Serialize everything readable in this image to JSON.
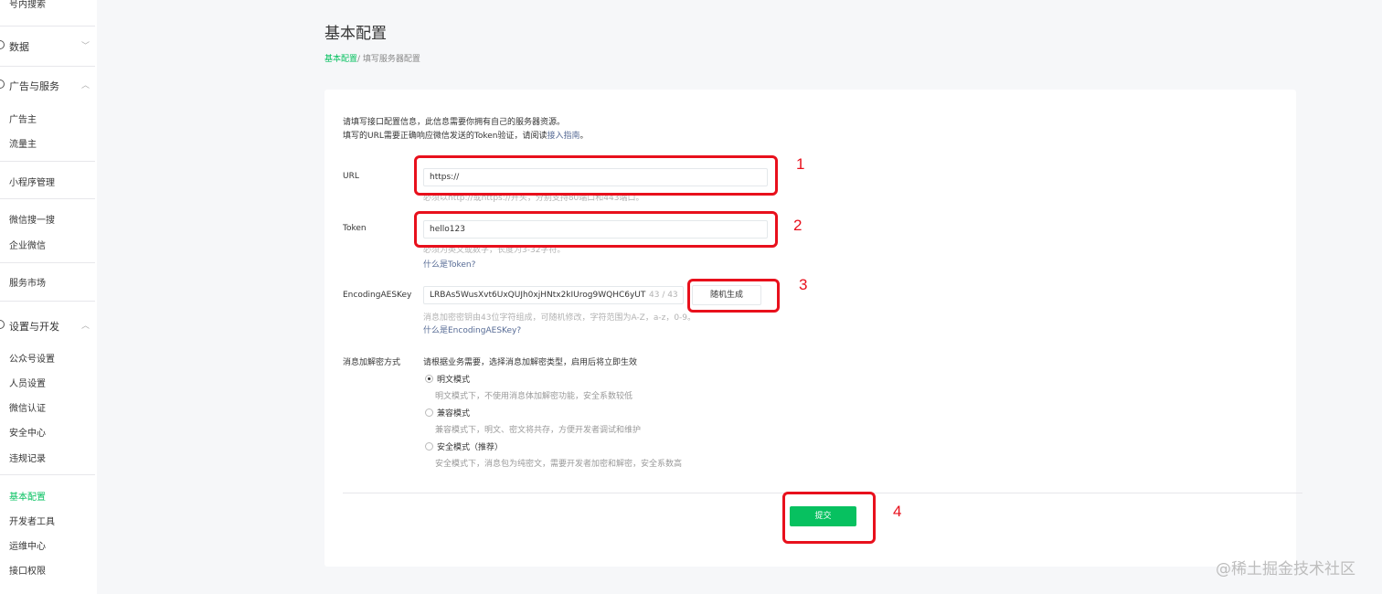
{
  "sidebar": {
    "top_item": "号内搜索",
    "groups": {
      "data": "数据",
      "ads": "广告与服务",
      "settings": "设置与开发"
    },
    "items": {
      "advertiser": "广告主",
      "traffic": "流量主",
      "miniprogram": "小程序管理",
      "search": "微信搜一搜",
      "wework": "企业微信",
      "market": "服务市场",
      "account_settings": "公众号设置",
      "staff": "人员设置",
      "verify": "微信认证",
      "security": "安全中心",
      "violations": "违规记录",
      "basic_config": "基本配置",
      "dev_tools": "开发者工具",
      "ops": "运维中心",
      "api_perm": "接口权限"
    }
  },
  "header": {
    "title": "基本配置",
    "breadcrumb_current": "基本配置",
    "breadcrumb_rest": "/ 填写服务器配置"
  },
  "form": {
    "intro_line1": "请填写接口配置信息，此信息需要你拥有自己的服务器资源。",
    "intro_line2_pre": "填写的URL需要正确响应微信发送的Token验证，请阅读",
    "intro_link": "接入指南",
    "intro_line2_post": "。",
    "url_label": "URL",
    "url_value": "https://",
    "url_hint": "必须以http://或https://开头，分别支持80端口和443端口。",
    "token_label": "Token",
    "token_value": "hello123",
    "token_hint": "必须为英文或数字，长度为3-32字符。",
    "token_link": "什么是Token?",
    "aes_label": "EncodingAESKey",
    "aes_value": "LRBAs5WusXvt6UxQUJh0xjHNtx2kIUrog9WQHC6yUT",
    "aes_counter": "43 / 43",
    "aes_button": "随机生成",
    "aes_hint": "消息加密密钥由43位字符组成，可随机修改，字符范围为A-Z，a-z，0-9。",
    "aes_link": "什么是EncodingAESKey?",
    "mode_label": "消息加解密方式",
    "mode_intro": "请根据业务需要，选择消息加解密类型，启用后将立即生效",
    "modes": [
      {
        "label": "明文模式",
        "desc": "明文模式下，不使用消息体加解密功能，安全系数较低",
        "selected": true
      },
      {
        "label": "兼容模式",
        "desc": "兼容模式下，明文、密文将共存，方便开发者调试和维护",
        "selected": false
      },
      {
        "label": "安全模式（推荐）",
        "desc": "安全模式下，消息包为纯密文，需要开发者加密和解密，安全系数高",
        "selected": false
      }
    ],
    "submit": "提交"
  },
  "annotations": [
    "1",
    "2",
    "3",
    "4"
  ],
  "watermark": "@稀土掘金技术社区",
  "colors": {
    "accent": "#07c160",
    "link": "#576b95",
    "annotation": "#e8101c"
  }
}
